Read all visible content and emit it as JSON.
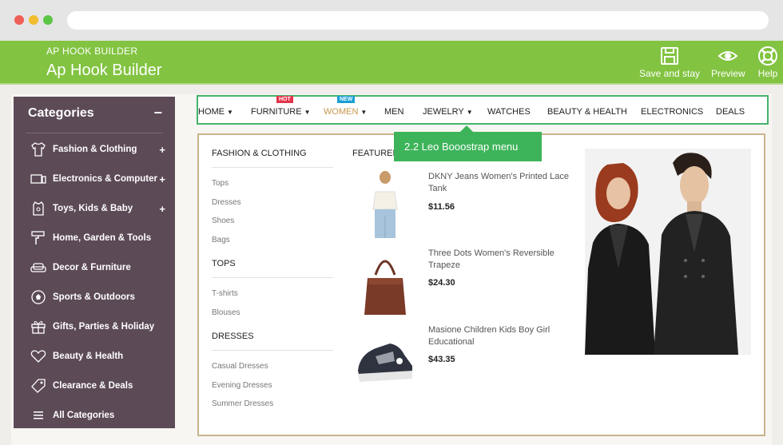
{
  "topbar": {
    "small_title": "AP HOOK BUILDER",
    "big_title": "Ap Hook Builder",
    "actions": [
      {
        "label": "Save and stay",
        "icon": "save-icon"
      },
      {
        "label": "Preview",
        "icon": "eye-icon"
      },
      {
        "label": "Help",
        "icon": "lifebuoy-icon"
      }
    ]
  },
  "colors": {
    "topbar": "#82c341",
    "sidebar": "#5c4a57",
    "menu_border": "#46b26b",
    "active": "#c8964c"
  },
  "sidebar": {
    "title": "Categories",
    "toggle": "−",
    "items": [
      {
        "label": "Fashion & Clothing",
        "icon": "shirt-icon",
        "expand": "+"
      },
      {
        "label": "Electronics & Computer",
        "icon": "devices-icon",
        "expand": "+"
      },
      {
        "label": "Toys, Kids & Baby",
        "icon": "baby-shirt-icon",
        "expand": "+"
      },
      {
        "label": "Home, Garden & Tools",
        "icon": "paint-roller-icon",
        "expand": ""
      },
      {
        "label": "Decor & Furniture",
        "icon": "sofa-icon",
        "expand": ""
      },
      {
        "label": "Sports & Outdoors",
        "icon": "soccer-ball-icon",
        "expand": ""
      },
      {
        "label": "Gifts, Parties & Holiday",
        "icon": "gift-icon",
        "expand": ""
      },
      {
        "label": "Beauty & Health",
        "icon": "heart-icon",
        "expand": ""
      },
      {
        "label": "Clearance & Deals",
        "icon": "tag-icon",
        "expand": ""
      },
      {
        "label": "All Categories",
        "icon": "menu-icon",
        "expand": ""
      }
    ]
  },
  "menu": {
    "items": [
      {
        "label": "HOME",
        "caret": "▼",
        "badge": ""
      },
      {
        "label": "FURNITURE",
        "caret": "▼",
        "badge": "HOT"
      },
      {
        "label": "WOMEN",
        "caret": "▼",
        "badge": "NEW"
      },
      {
        "label": "MEN",
        "caret": "",
        "badge": ""
      },
      {
        "label": "JEWELRY",
        "caret": "▼",
        "badge": ""
      },
      {
        "label": "WATCHES",
        "caret": "",
        "badge": ""
      },
      {
        "label": "BEAUTY & HEALTH",
        "caret": "",
        "badge": ""
      },
      {
        "label": "ELECTRONICS",
        "caret": "",
        "badge": ""
      },
      {
        "label": "DEALS",
        "caret": "",
        "badge": ""
      }
    ],
    "tooltip": "2.2 Leo Booostrap menu"
  },
  "dropdown": {
    "columns": [
      {
        "title": "FASHION & CLOTHING",
        "links": [
          "Tops",
          "Dresses",
          "Shoes",
          "Bags"
        ]
      },
      {
        "title": "TOPS",
        "links": [
          "T-shirts",
          "Blouses"
        ]
      },
      {
        "title": "DRESSES",
        "links": [
          "Casual Dresses",
          "Evening Dresses",
          "Summer Dresses"
        ]
      }
    ],
    "featured_title": "FEATURED",
    "products": [
      {
        "name": "DKNY Jeans Women's Printed Lace Tank",
        "price": "$11.56"
      },
      {
        "name": "Three Dots Women's Reversible Trapeze",
        "price": "$24.30"
      },
      {
        "name": "Masione Children Kids Boy Girl Educational",
        "price": "$43.35"
      }
    ]
  }
}
